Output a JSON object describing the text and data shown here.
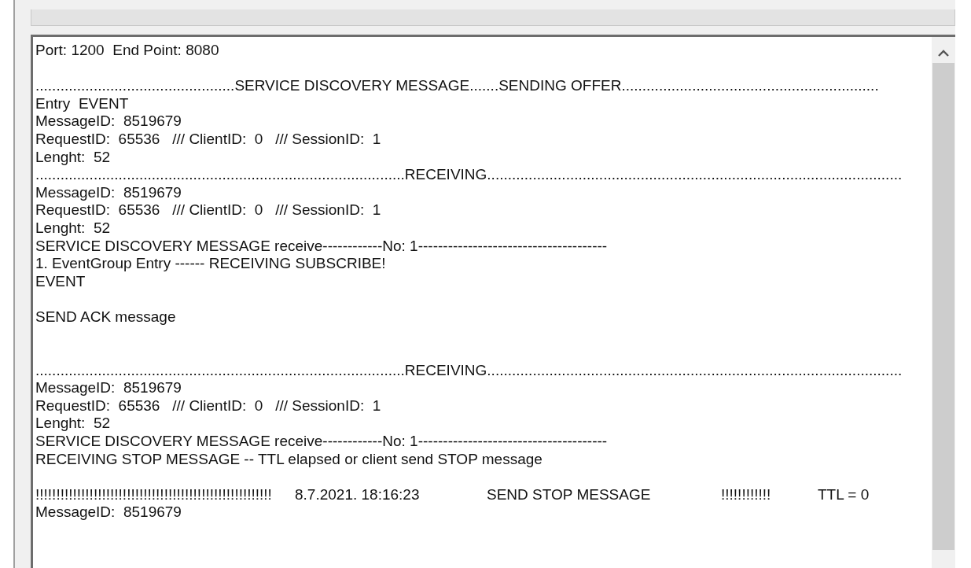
{
  "log": {
    "lines": [
      {
        "kind": "text",
        "text": "Port: 1200  End Point: 8080"
      },
      {
        "kind": "blank"
      },
      {
        "kind": "text",
        "text": "................................................SERVICE DISCOVERY MESSAGE.......SENDING OFFER.............................................................."
      },
      {
        "kind": "text",
        "text": "Entry  EVENT"
      },
      {
        "kind": "text",
        "text": "MessageID:  8519679"
      },
      {
        "kind": "text",
        "text": "RequestID:  65536   /// ClientID:  0   /// SessionID:  1"
      },
      {
        "kind": "text",
        "text": "Lenght:  52"
      },
      {
        "kind": "text",
        "text": ".........................................................................................RECEIVING...................................................................................................."
      },
      {
        "kind": "text",
        "text": "MessageID:  8519679"
      },
      {
        "kind": "text",
        "text": "RequestID:  65536   /// ClientID:  0   /// SessionID:  1"
      },
      {
        "kind": "text",
        "text": "Lenght:  52"
      },
      {
        "kind": "text",
        "text": "SERVICE DISCOVERY MESSAGE receive------------No: 1--------------------------------------"
      },
      {
        "kind": "text",
        "text": "1. EventGroup Entry ------ RECEIVING SUBSCRIBE!"
      },
      {
        "kind": "text",
        "text": "EVENT"
      },
      {
        "kind": "blank"
      },
      {
        "kind": "text",
        "text": "SEND ACK message"
      },
      {
        "kind": "blank"
      },
      {
        "kind": "blank"
      },
      {
        "kind": "text",
        "text": ".........................................................................................RECEIVING...................................................................................................."
      },
      {
        "kind": "text",
        "text": "MessageID:  8519679"
      },
      {
        "kind": "text",
        "text": "RequestID:  65536   /// ClientID:  0   /// SessionID:  1"
      },
      {
        "kind": "text",
        "text": "Lenght:  52"
      },
      {
        "kind": "text",
        "text": "SERVICE DISCOVERY MESSAGE receive------------No: 1--------------------------------------"
      },
      {
        "kind": "text",
        "text": "RECEIVING STOP MESSAGE -- TTL elapsed or client send STOP message"
      },
      {
        "kind": "blank"
      },
      {
        "kind": "tabbed",
        "segments": [
          "!!!!!!!!!!!!!!!!!!!!!!!!!!!!!!!!!!!!!!!!!!!!!!!!!!!!!!!!!",
          "8.7.2021. 18:16:23",
          "SEND STOP MESSAGE",
          "!!!!!!!!!!!!",
          "TTL = 0"
        ]
      },
      {
        "kind": "text",
        "text": "MessageID:  8519679"
      }
    ]
  }
}
